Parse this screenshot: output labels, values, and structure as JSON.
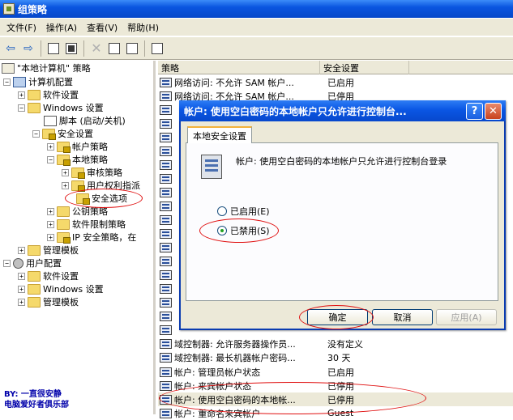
{
  "window": {
    "title": "组策略"
  },
  "menu": {
    "items": [
      "文件(F)",
      "操作(A)",
      "查看(V)",
      "帮助(H)"
    ]
  },
  "tree": {
    "root": "\"本地计算机\" 策略",
    "computer_config": "计算机配置",
    "software_settings": "软件设置",
    "windows_settings": "Windows 设置",
    "scripts": "脚本 (启动/关机)",
    "security_settings": "安全设置",
    "account_policies": "帐户策略",
    "local_policies": "本地策略",
    "audit_policy": "审核策略",
    "user_rights": "用户权利指派",
    "security_options": "安全选项",
    "public_key": "公钥策略",
    "software_restriction": "软件限制策略",
    "ip_security": "IP 安全策略，在",
    "admin_templates": "管理模板",
    "user_config": "用户配置",
    "user_software_settings": "软件设置",
    "user_windows_settings": "Windows 设置",
    "user_admin_templates": "管理模板"
  },
  "signature": {
    "line1": "BY: 一直很安静",
    "line2": "电脑爱好者俱乐部"
  },
  "list": {
    "col_policy": "策略",
    "col_setting": "安全设置",
    "rows": [
      {
        "policy": "网络访问: 不允许 SAM 帐户...",
        "setting": "已启用"
      },
      {
        "policy": "网络访问: 不允许 SAM 帐户...",
        "setting": "已停用"
      },
      {
        "policy": "域控制器: 允许服务器操作员...",
        "setting": "没有定义"
      },
      {
        "policy": "域控制器: 最长机器帐户密码...",
        "setting": "30 天"
      },
      {
        "policy": "帐户: 管理员帐户状态",
        "setting": "已启用"
      },
      {
        "policy": "帐户: 来宾帐户状态",
        "setting": "已停用"
      },
      {
        "policy": "帐户: 使用空白密码的本地帐...",
        "setting": "已停用"
      },
      {
        "policy": "帐户: 重命名来宾帐户",
        "setting": "Guest"
      }
    ]
  },
  "dialog": {
    "title": "帐户: 使用空白密码的本地帐户只允许进行控制台...",
    "help": "?",
    "close": "✕",
    "tab": "本地安全设置",
    "description": "帐户: 使用空白密码的本地帐户只允许进行控制台登录",
    "option_enabled": "已启用(E)",
    "option_disabled": "已禁用(S)",
    "ok": "确定",
    "cancel": "取消",
    "apply": "应用(A)"
  },
  "colors": {
    "annotation": "#e01010",
    "titlebar": "#0a55e0"
  }
}
